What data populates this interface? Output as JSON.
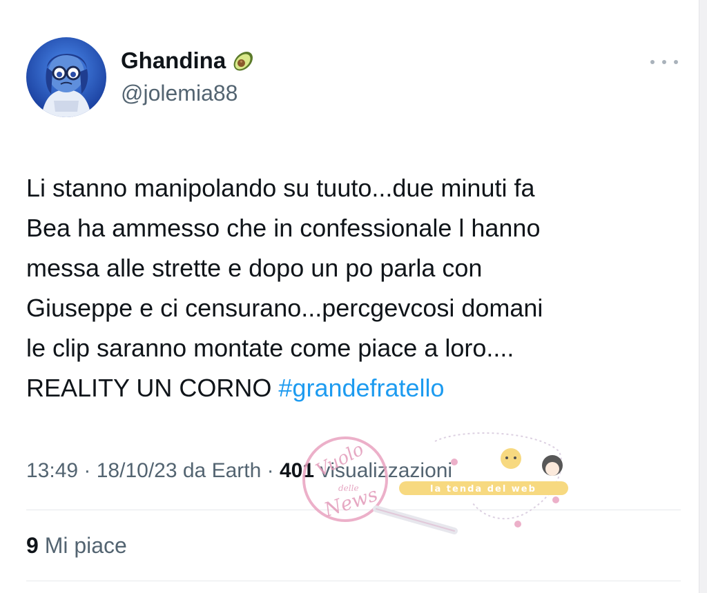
{
  "tweet": {
    "display_name": "Ghandina",
    "name_emoji_icon": "avocado-icon",
    "handle": "@jolemia88",
    "lines": [
      "Li stanno manipolando su tuuto...due minuti fa",
      "Bea ha ammesso che in confessionale l hanno",
      "messa alle strette e dopo un po parla con",
      "Giuseppe e ci censurano...percgevcosi domani",
      "le clip saranno montate come piace a loro...."
    ],
    "last_line_text": "REALITY UN CORNO ",
    "hashtag": "#grandefratello",
    "time": "13:49",
    "sep1": " · ",
    "date": "18/10/23",
    "source": " da Earth",
    "sep2": " · ",
    "views_count": "401",
    "views_label": " visualizzazioni",
    "likes_count": "9",
    "likes_label": " Mi piace"
  },
  "watermark": {
    "brand_line1": "Vuolo",
    "brand_line2": "delle",
    "brand_line3": "News",
    "ribbon": "la tenda del web"
  },
  "colors": {
    "hashtag": "#1d9bf0",
    "secondary_text": "#536471",
    "primary_text": "#0f1419",
    "watermark_pink": "#e9a3c0"
  }
}
